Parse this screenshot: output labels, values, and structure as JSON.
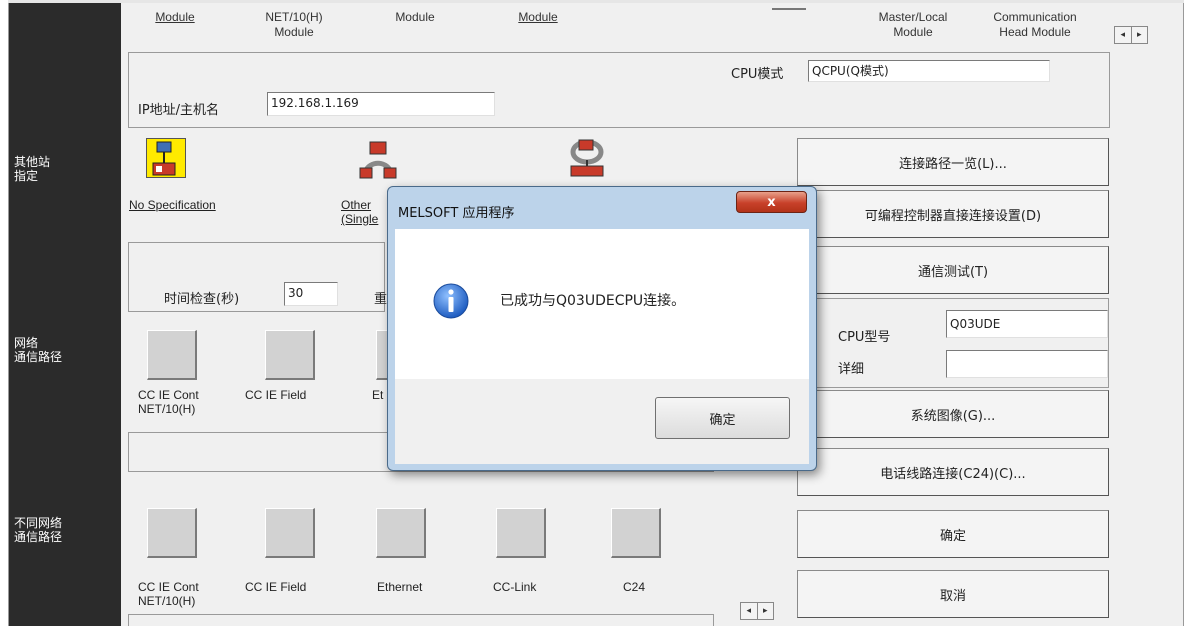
{
  "top_labels": [
    {
      "text": "Module",
      "underline": true
    },
    {
      "line1": "NET/10(H)",
      "line2": "Module"
    },
    {
      "text": "Module"
    },
    {
      "text": "Module",
      "underline": true
    },
    {
      "line1": "Master/Local",
      "line2": "Module"
    },
    {
      "line1": "Communication",
      "line2": "Head Module"
    }
  ],
  "cpu_mode": {
    "label": "CPU模式",
    "value": "QCPU(Q模式)"
  },
  "ip": {
    "label": "IP地址/主机名",
    "value": "192.168.1.169"
  },
  "side_labels": {
    "other_station": [
      "其他站",
      "指定"
    ],
    "network_route": [
      "网络",
      "通信路径"
    ],
    "diff_network_route": [
      "不同网络",
      "通信路径"
    ]
  },
  "other_station": {
    "no_spec": "No Specification",
    "other_partial_1": "Other",
    "other_partial_2": "(Single"
  },
  "time_check": {
    "label": "时间检查(秒)",
    "value": "30",
    "partial_next": "重"
  },
  "network_items": [
    {
      "line1": "CC IE Cont",
      "line2": "NET/10(H)"
    },
    {
      "line1": "CC IE Field",
      "line2": ""
    },
    {
      "line1": "Et",
      "line2": ""
    }
  ],
  "diff_network_items": [
    {
      "line1": "CC IE Cont",
      "line2": "NET/10(H)"
    },
    {
      "line1": "CC IE Field",
      "line2": ""
    },
    {
      "line1": "Ethernet",
      "line2": ""
    },
    {
      "line1": "CC-Link",
      "line2": ""
    },
    {
      "line1": "C24",
      "line2": ""
    }
  ],
  "side_buttons": {
    "route_list": "连接路径一览(L)...",
    "direct_setting": "可编程控制器直接连接设置(D)",
    "comm_test": "通信测试(T)",
    "system_image": "系统图像(G)...",
    "phone_line": "电话线路连接(C24)(C)...",
    "ok": "确定",
    "cancel": "取消"
  },
  "cpu_info": {
    "model_label": "CPU型号",
    "model_value": "Q03UDE",
    "detail_label": "详细",
    "detail_value": ""
  },
  "dialog": {
    "title": "MELSOFT 应用程序",
    "close": "x",
    "message": "已成功与Q03UDECPU连接。",
    "ok": "确定"
  },
  "scroll": {
    "left": "◂",
    "right": "▸"
  },
  "colors": {
    "left_bar": "#2b2b2b",
    "info_icon": "#1e64c8",
    "close_button": "#c8412a"
  }
}
